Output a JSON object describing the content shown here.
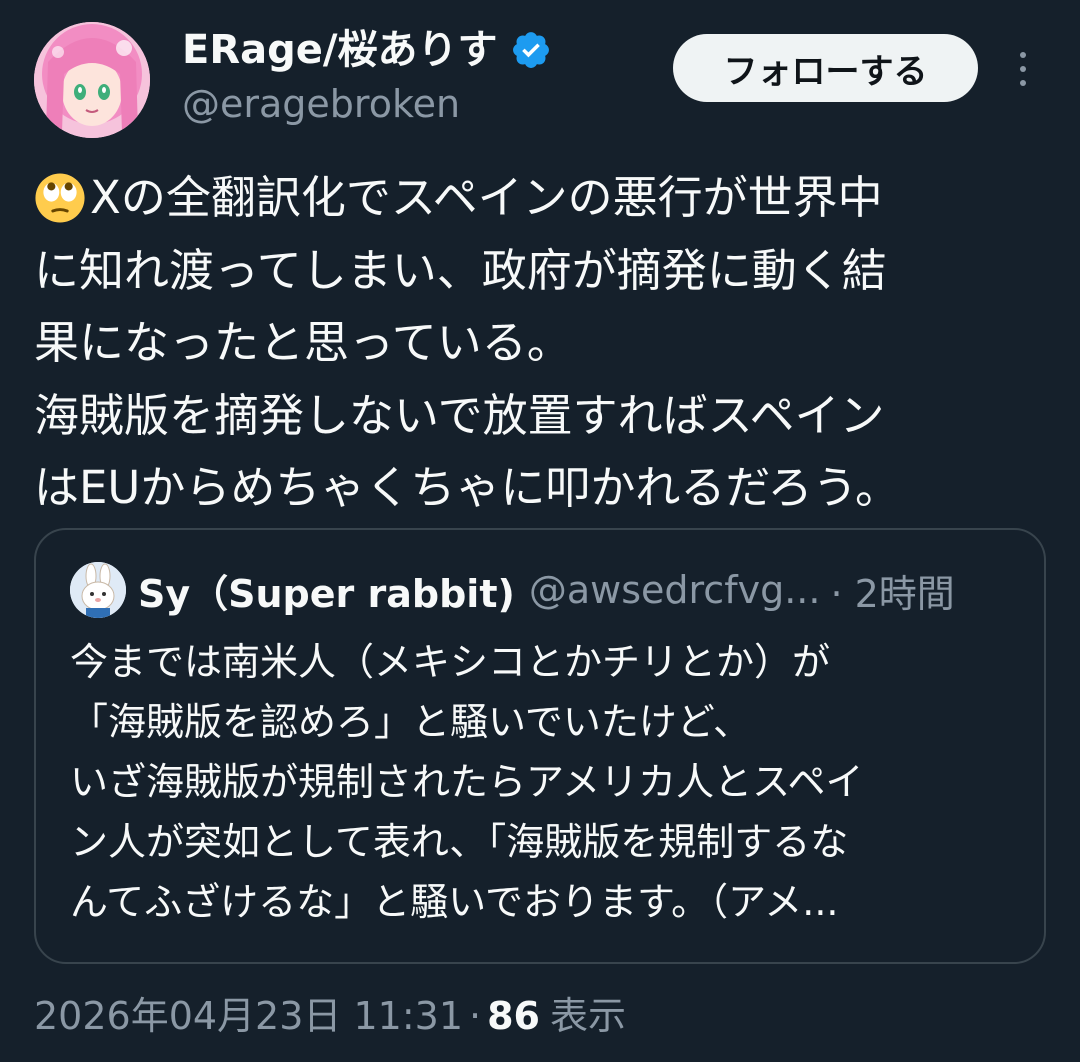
{
  "author": {
    "display_name": "ERage/桜ありす",
    "handle": "@eragebroken",
    "verified": true,
    "avatar_icon": "anime-avatar-pink-hair"
  },
  "actions": {
    "follow_label": "フォローする",
    "more_icon": "more-vertical-icon"
  },
  "tweet": {
    "emoji": "face-with-rolling-eyes",
    "lines": [
      "Xの全翻訳化でスペインの悪行が世界中",
      "に知れ渡ってしまい、政府が摘発に動く結",
      "果になったと思っている。",
      "海賊版を摘発しないで放置すればスペイン",
      "はEUからめちゃくちゃに叩かれるだろう。"
    ]
  },
  "quote": {
    "display_name": "Sy（Super rabbit)",
    "handle": "@awsedrcfvg...",
    "time": "· 2時間",
    "avatar_icon": "rabbit-avatar",
    "lines": [
      "今までは南米人（メキシコとかチリとか）が",
      "「海賊版を認めろ」と騒いでいたけど、",
      "いざ海賊版が規制されたらアメリカ人とスペイ",
      "ン人が突如として表れ、「海賊版を規制するな",
      "んてふざけるな」と騒いでおります。（アメ..."
    ]
  },
  "meta": {
    "timestamp": "2026年04月23日 11:31",
    "separator": "·",
    "views_count": "86",
    "views_label": "表示"
  },
  "colors": {
    "background": "#15202b",
    "text_primary": "#f7f9f9",
    "text_secondary": "#8b98a5",
    "verified_blue": "#1d9bf0",
    "border": "#38444d",
    "follow_button_bg": "#eff3f4"
  }
}
